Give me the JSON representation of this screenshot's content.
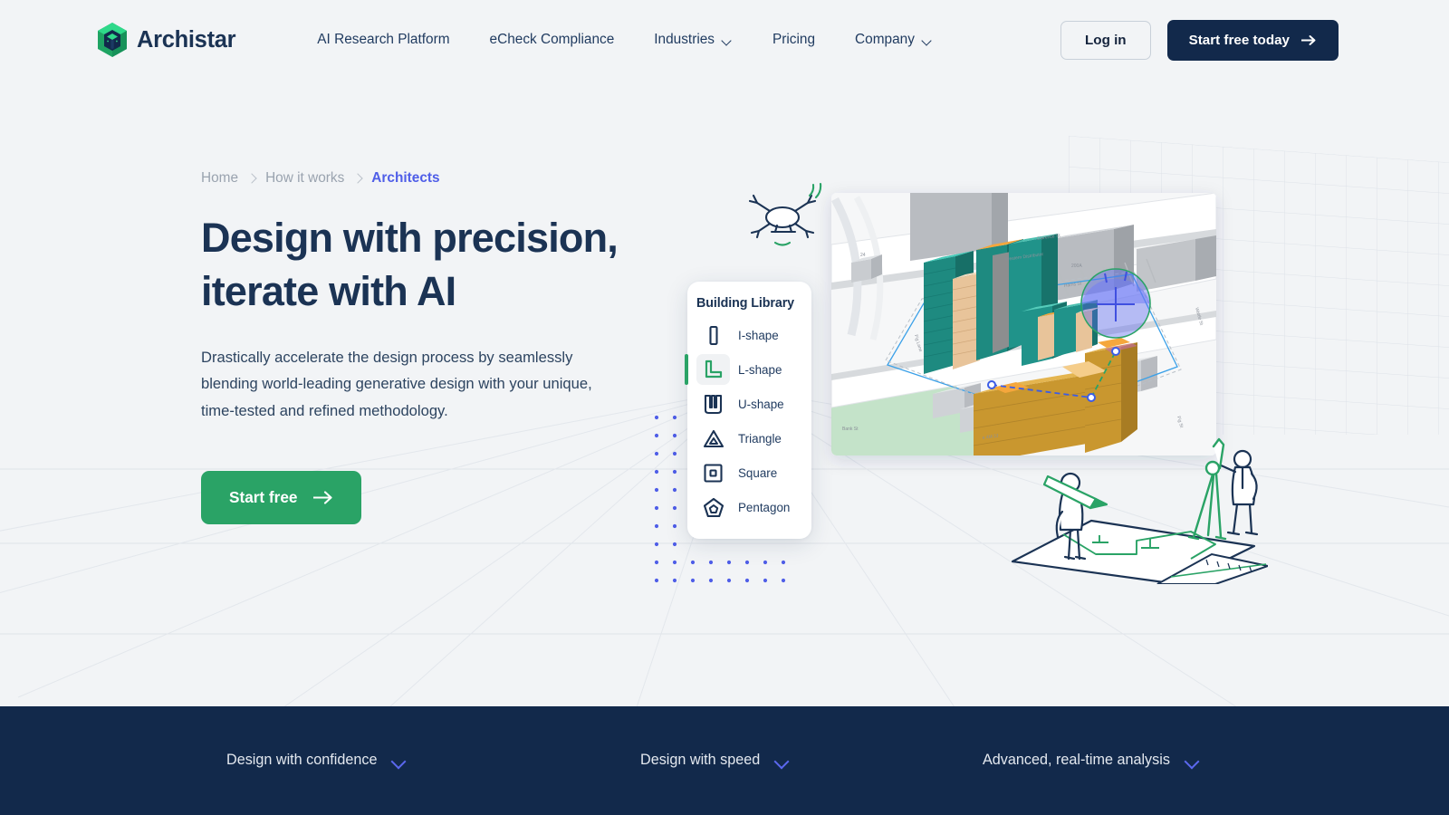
{
  "brand": {
    "name": "Archistar",
    "mark_icon": "archistar-hexagon-logo"
  },
  "nav": {
    "links": [
      {
        "label": "AI Research Platform",
        "has_dropdown": false
      },
      {
        "label": "eCheck Compliance",
        "has_dropdown": false
      },
      {
        "label": "Industries",
        "has_dropdown": true
      },
      {
        "label": "Pricing",
        "has_dropdown": false
      },
      {
        "label": "Company",
        "has_dropdown": true
      }
    ],
    "login_label": "Log in",
    "cta_label": "Start free today",
    "cta_icon": "arrow-right-icon"
  },
  "breadcrumb": [
    {
      "label": "Home",
      "active": false
    },
    {
      "label": "How it works",
      "active": false
    },
    {
      "label": "Architects",
      "active": true
    }
  ],
  "hero": {
    "headline_line1": "Design with precision,",
    "headline_line2": "iterate with AI",
    "subcopy": "Drastically accelerate the design process by seamlessly blending world-leading generative design with your unique, time-tested and refined methodology.",
    "cta_label": "Start free",
    "cta_icon": "arrow-right-icon"
  },
  "building_library": {
    "title": "Building Library",
    "items": [
      {
        "label": "I-shape",
        "icon": "i-shape-icon",
        "selected": false
      },
      {
        "label": "L-shape",
        "icon": "l-shape-icon",
        "selected": true
      },
      {
        "label": "U-shape",
        "icon": "u-shape-icon",
        "selected": false
      },
      {
        "label": "Triangle",
        "icon": "triangle-icon",
        "selected": false
      },
      {
        "label": "Square",
        "icon": "square-icon",
        "selected": false
      },
      {
        "label": "Pentagon",
        "icon": "pentagon-icon",
        "selected": false
      }
    ]
  },
  "render_scene": {
    "street_labels": [
      "Western Distributor",
      "Fig St",
      "Fox St",
      "200A",
      "24"
    ],
    "illustrations": [
      "drone-icon",
      "surveyor-with-pencil",
      "surveyor-with-tripod",
      "blueprint-plan"
    ]
  },
  "bottom_bar": {
    "items": [
      {
        "label": "Design with confidence",
        "icon": "chevron-down-icon"
      },
      {
        "label": "Design with speed",
        "icon": "chevron-down-icon"
      },
      {
        "label": "Advanced, real-time analysis",
        "icon": "chevron-down-icon"
      }
    ]
  },
  "colors": {
    "page_bg": "#f2f4f6",
    "navy": "#12294b",
    "heading": "#1b3354",
    "green": "#2aa366",
    "green_light": "#2ecc80",
    "accent_indigo": "#4f5ee8",
    "muted": "#9aa3af",
    "bottom_bar_bg": "#12294b"
  }
}
